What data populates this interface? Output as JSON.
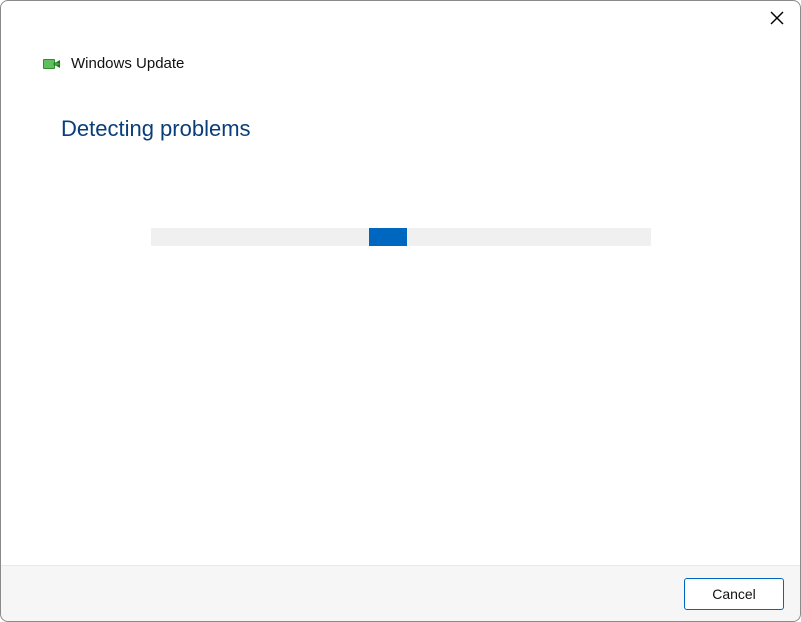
{
  "header": {
    "title": "Windows Update"
  },
  "main": {
    "heading": "Detecting problems"
  },
  "footer": {
    "cancel_label": "Cancel"
  },
  "colors": {
    "accent": "#0067c0",
    "heading_color": "#0a3e7a",
    "track_bg": "#f0f0f0",
    "footer_bg": "#f6f6f6"
  },
  "progress": {
    "indeterminate": true,
    "thumb_position_percent": 44
  }
}
